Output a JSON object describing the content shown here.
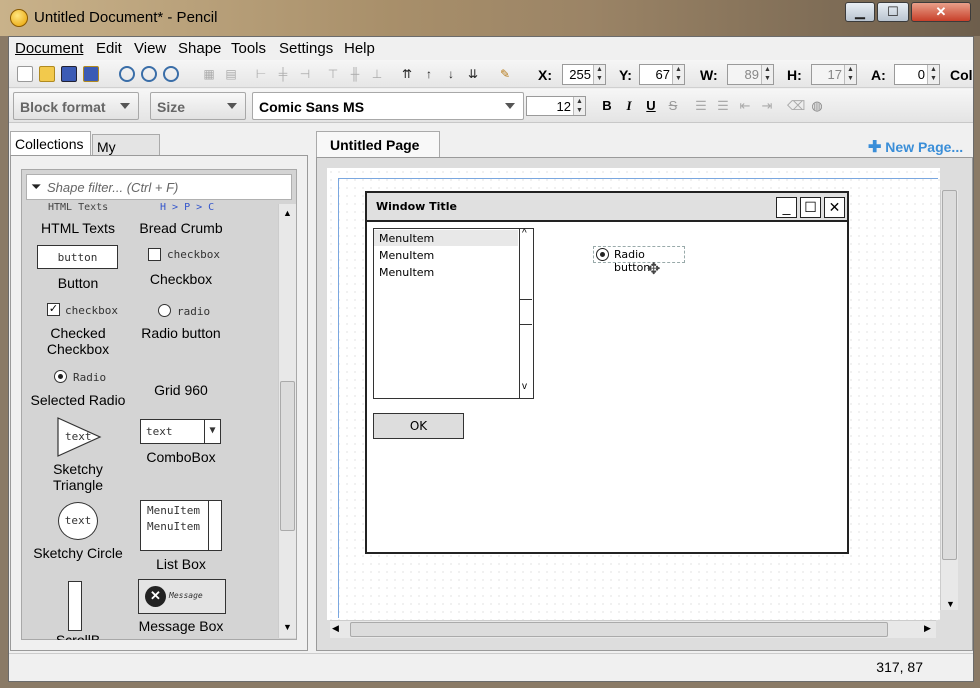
{
  "window": {
    "title": "Untitled Document* - Pencil",
    "minimize": "▁",
    "maximize": "☐",
    "close": "✕"
  },
  "menu": [
    "Document",
    "Edit",
    "View",
    "Shape",
    "Tools",
    "Settings",
    "Help"
  ],
  "geometry": {
    "x_label": "X:",
    "x_value": "255",
    "y_label": "Y:",
    "y_value": "67",
    "w_label": "W:",
    "w_value": "89",
    "h_label": "H:",
    "h_value": "17",
    "a_label": "A:",
    "a_value": "0",
    "col_label": "Col"
  },
  "format": {
    "block_format": "Block format",
    "size": "Size",
    "font": "Comic Sans MS",
    "font_size": "12",
    "bold": "B",
    "italic": "I",
    "underline": "U",
    "strike": "S"
  },
  "left_panel": {
    "tabs": [
      "Collections",
      "My Stuffs"
    ],
    "filter_placeholder": "Shape filter... (Ctrl + F)",
    "shapes": {
      "html_texts": {
        "preview": "HTML Texts",
        "name": "HTML Texts"
      },
      "bread_crumb": {
        "preview": "H > P > C",
        "name": "Bread Crumb"
      },
      "button": {
        "preview": "button",
        "name": "Button"
      },
      "checkbox": {
        "preview": "checkbox",
        "name": "Checkbox"
      },
      "checked_checkbox": {
        "preview": "checkbox",
        "name": "Checked Checkbox"
      },
      "radio_button": {
        "preview": "radio",
        "name": "Radio button"
      },
      "selected_radio": {
        "preview": "Radio",
        "name": "Selected Radio"
      },
      "grid_960": {
        "name": "Grid 960"
      },
      "sketchy_triangle": {
        "preview": "text",
        "name": "Sketchy Triangle"
      },
      "combobox": {
        "preview": "text",
        "name": "ComboBox"
      },
      "sketchy_circle": {
        "preview": "text",
        "name": "Sketchy Circle"
      },
      "list_box": {
        "preview_item1": "MenuItem",
        "preview_item2": "MenuItem",
        "name": "List Box"
      },
      "scroll": {
        "name": "ScrollB"
      },
      "message_box": {
        "preview": "Message",
        "name": "Message Box"
      }
    }
  },
  "page": {
    "tab": "Untitled Page",
    "new_page": "New Page..."
  },
  "mockup": {
    "window_title": "Window Title",
    "list_items": [
      "MenuItem",
      "MenuItem",
      "MenuItem"
    ],
    "ok_button": "OK",
    "radio_label": "Radio button"
  },
  "status": {
    "coords": "317, 87"
  }
}
